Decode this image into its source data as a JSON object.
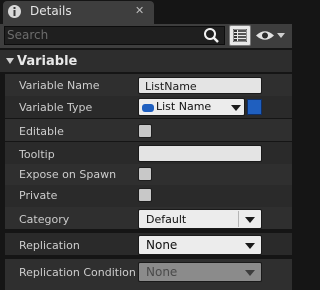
{
  "tab": {
    "title": "Details",
    "close": "✕",
    "icon": "info-icon"
  },
  "search": {
    "placeholder": "Search"
  },
  "toolbar": {
    "grid_icon": "property-matrix-icon",
    "eye_icon": "eye-icon"
  },
  "category": {
    "title": "Variable"
  },
  "properties": {
    "variable_name": {
      "label": "Variable Name",
      "value": "ListName"
    },
    "variable_type": {
      "label": "Variable Type",
      "value": "List Name",
      "pin_color": "#1f5fbf"
    },
    "editable": {
      "label": "Editable"
    },
    "tooltip": {
      "label": "Tooltip",
      "value": ""
    },
    "expose_on_spawn": {
      "label": "Expose on Spawn"
    },
    "private": {
      "label": "Private"
    },
    "category": {
      "label": "Category",
      "value": "Default"
    },
    "replication": {
      "label": "Replication",
      "value": "None"
    },
    "replication_condition": {
      "label": "Replication Condition",
      "value": "None"
    }
  }
}
